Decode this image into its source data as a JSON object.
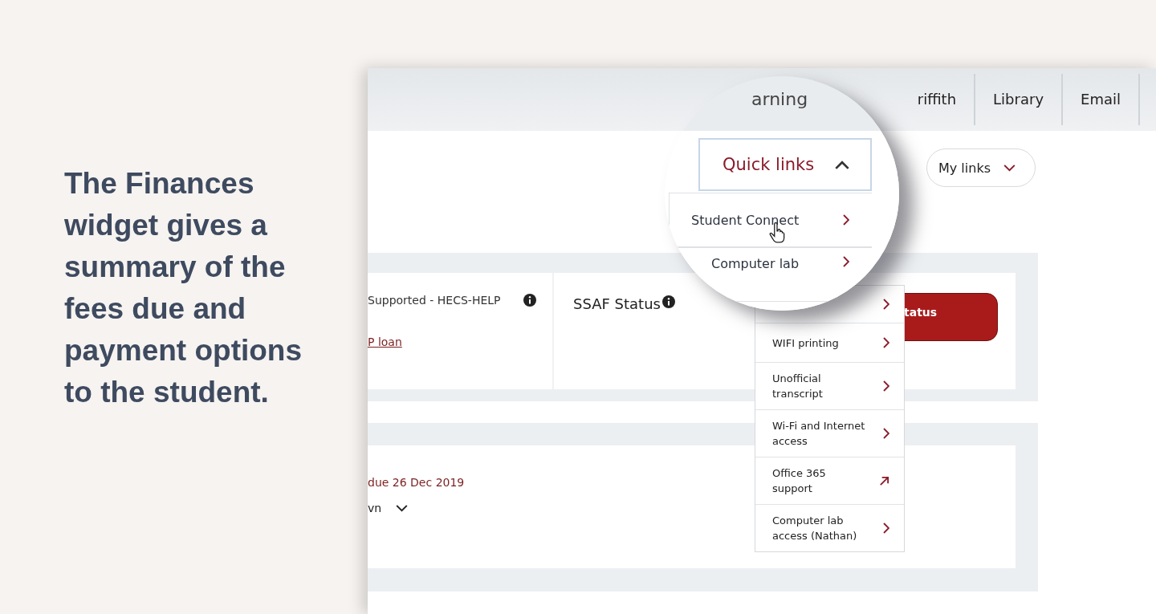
{
  "caption": "The Finances widget gives a summary of the fees due and payment options to the student.",
  "top_nav": {
    "partial_label": "arning",
    "items": [
      "riffith",
      "Library",
      "Email"
    ]
  },
  "quick_links": {
    "label": "Quick links",
    "expanded": true,
    "items": [
      {
        "label": "Student Connect",
        "kind": "internal"
      },
      {
        "label": "Computer lab",
        "kind": "internal"
      },
      {
        "label": "WIFI printing",
        "kind": "internal"
      },
      {
        "label": "Unofficial transcript",
        "kind": "internal"
      },
      {
        "label": "Wi-Fi and Internet access",
        "kind": "internal"
      },
      {
        "label": "Office 365 support",
        "kind": "external"
      },
      {
        "label": "Computer lab access (Nathan)",
        "kind": "internal"
      }
    ]
  },
  "my_links": {
    "label": "My links",
    "expanded": false
  },
  "loan_card": {
    "support_text": "Supported - HECS-HELP",
    "loan_link": "P loan",
    "ssaf_title": "SSAF Status",
    "status_button": "tatus"
  },
  "fees_card": {
    "due_text": "due 26 Dec 2019",
    "toggle_label": "vn"
  }
}
